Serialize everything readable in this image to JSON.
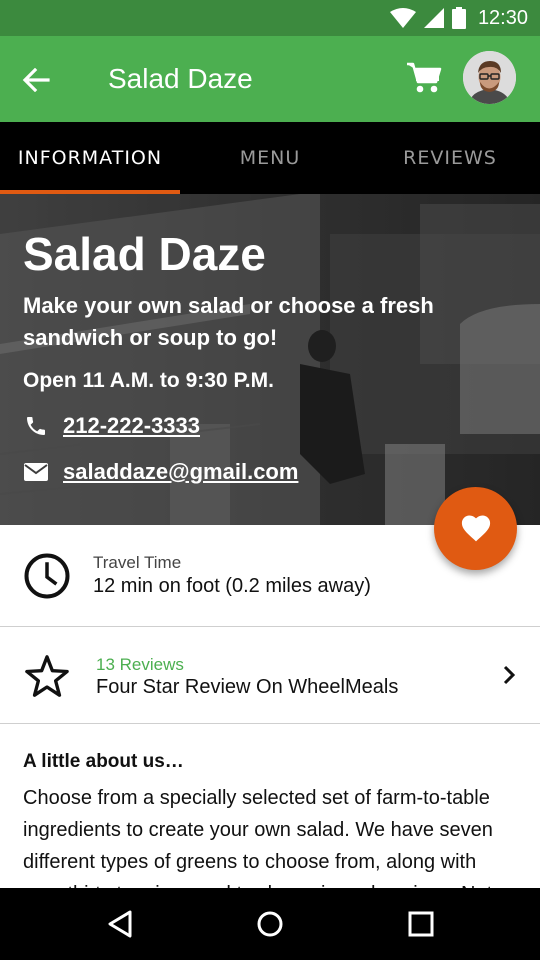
{
  "status": {
    "time": "12:30"
  },
  "header": {
    "title": "Salad Daze"
  },
  "tabs": [
    {
      "label": "INFORMATION",
      "active": true
    },
    {
      "label": "MENU",
      "active": false
    },
    {
      "label": "REVIEWS",
      "active": false
    }
  ],
  "hero": {
    "title": "Salad Daze",
    "description": "Make your own salad or choose a fresh sandwich or soup to go!",
    "hours": "Open 11 A.M. to 9:30 P.M.",
    "phone": "212-222-3333",
    "email": "saladdaze@gmail.com"
  },
  "travel": {
    "label": "Travel Time",
    "value": "12 min on foot (0.2 miles away)"
  },
  "reviews": {
    "count_label": "13 Reviews",
    "summary": "Four Star Review On WheelMeals"
  },
  "about": {
    "title": "A little about us…",
    "text": "Choose from a specially selected set of farm-to-table ingredients to create your own salad. We have seven different types of greens to choose from, along with over thirty toppings and twelve unique dressings. Not"
  },
  "colors": {
    "primary": "#4caf50",
    "primary_dark": "#3c8a3e",
    "accent": "#e05a12"
  },
  "icons": {
    "back": "arrow-back-icon",
    "cart": "cart-icon",
    "phone": "phone-icon",
    "email": "email-icon",
    "favorite": "heart-icon",
    "clock": "clock-icon",
    "star": "star-icon",
    "chevron": "chevron-right-icon"
  }
}
